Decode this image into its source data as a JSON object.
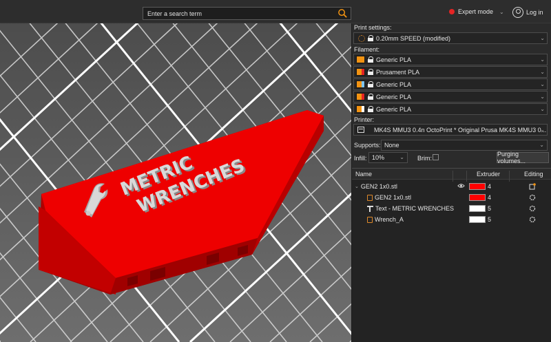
{
  "search": {
    "placeholder": "Enter a search term",
    "icon": "search-icon"
  },
  "header": {
    "mode_label": "Expert mode",
    "mode_color": "#e52424",
    "login_label": "Log in"
  },
  "print_settings": {
    "label": "Print settings:",
    "value": "0.20mm SPEED (modified)"
  },
  "filament": {
    "label": "Filament:",
    "items": [
      {
        "name": "Generic PLA",
        "color": "#f29312",
        "accent": "#f29312"
      },
      {
        "name": "Prusament PLA",
        "color": "#f29312",
        "accent": "#e52424"
      },
      {
        "name": "Generic PLA",
        "color": "#f29312",
        "accent": "#7ec4f0"
      },
      {
        "name": "Generic PLA",
        "color": "#f29312",
        "accent": "#e52424"
      },
      {
        "name": "Generic PLA",
        "color": "#f29312",
        "accent": "#ffffff"
      }
    ]
  },
  "printer": {
    "label": "Printer:",
    "value": "MK4S MMU3 0.4n OctoPrint * Original Prusa MK4S MMU3 0..."
  },
  "supports": {
    "label": "Supports:",
    "value": "None"
  },
  "infill": {
    "label": "Infill:",
    "value": "10%"
  },
  "brim": {
    "label": "Brim:"
  },
  "purge_button": "Purging volumes...",
  "table": {
    "headers": {
      "name": "Name",
      "extruder": "Extruder",
      "editing": "Editing"
    },
    "rows": [
      {
        "name": "GEN2 1x0.stl",
        "extruder": "4",
        "color": "#ff0000",
        "level": 0,
        "icon": "expand"
      },
      {
        "name": "GEN2 1x0.stl",
        "extruder": "4",
        "color": "#ff0000",
        "level": 1,
        "icon": "part"
      },
      {
        "name": "Text - METRIC WRENCHES",
        "extruder": "5",
        "color": "#ffffff",
        "level": 1,
        "icon": "text"
      },
      {
        "name": "Wrench_A",
        "extruder": "5",
        "color": "#ffffff",
        "level": 1,
        "icon": "part"
      }
    ]
  },
  "model": {
    "text_line1": "METRIC",
    "text_line2": "WRENCHES",
    "plate_color": "#d00000",
    "text_color": "#cfcfcf"
  }
}
